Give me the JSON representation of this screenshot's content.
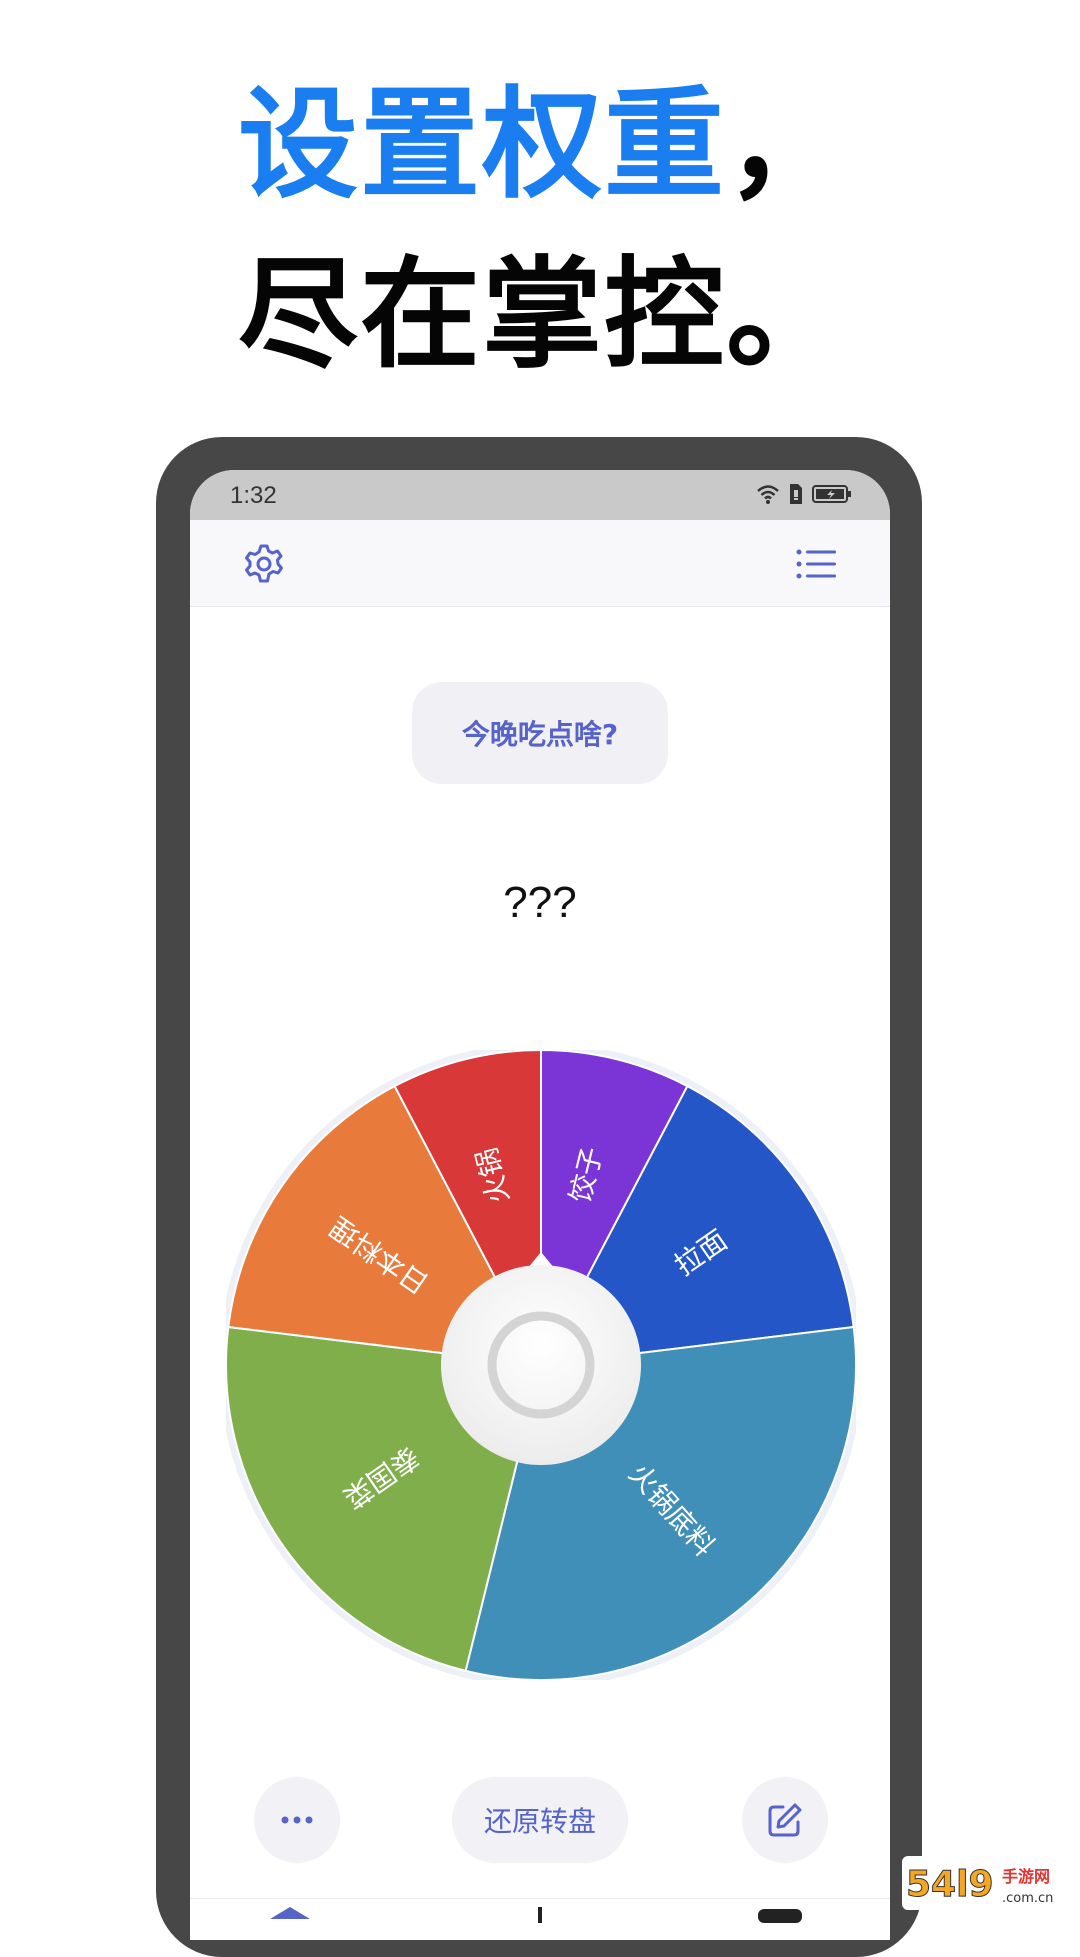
{
  "headline": {
    "line1": "设置权重，",
    "line1_colored": "设置权重",
    "line1_tail": "，",
    "line2": "尽在掌控。"
  },
  "status_bar": {
    "time": "1:32"
  },
  "app_bar": {
    "settings_icon": "gear-icon",
    "list_icon": "list-icon"
  },
  "question": {
    "label": "今晚吃点啥?"
  },
  "result": {
    "text": "???"
  },
  "wheel": {
    "segments": [
      {
        "label": "饺子",
        "weight": 1,
        "color": "#7b34d6"
      },
      {
        "label": "拉面",
        "weight": 2,
        "color": "#2456c8"
      },
      {
        "label": "火锅底料",
        "weight": 4,
        "color": "#3f8fb8"
      },
      {
        "label": "泰国菜",
        "weight": 3,
        "color": "#7fae4a"
      },
      {
        "label": "日本料理",
        "weight": 2,
        "color": "#e87a3c"
      },
      {
        "label": "火锅",
        "weight": 1,
        "color": "#d93838"
      }
    ]
  },
  "actions": {
    "more_icon": "more-icon",
    "reset_label": "还原转盘",
    "edit_icon": "edit-icon"
  },
  "colors": {
    "accent": "#5663c8",
    "headline_blue": "#1a7ef0",
    "frame": "#474747"
  },
  "watermark": {
    "text": "54l9手游网 .com.cn"
  }
}
